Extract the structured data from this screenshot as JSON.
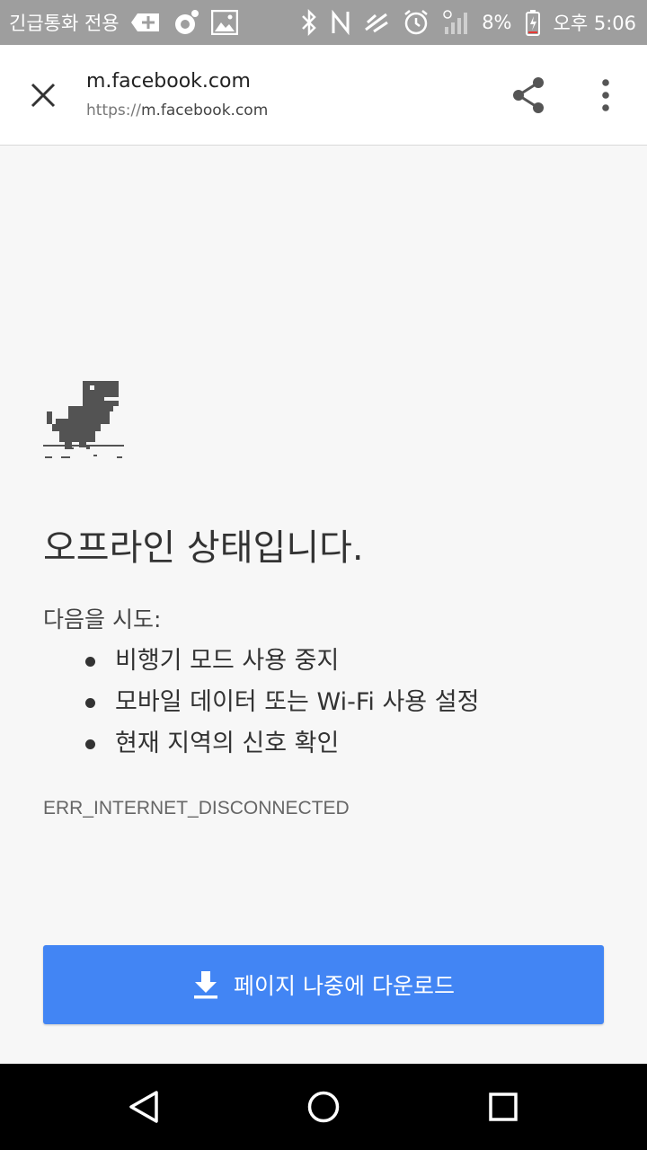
{
  "status_bar": {
    "carrier": "긴급통화 전용",
    "battery": "8%",
    "time": "오후 5:06",
    "icons": [
      "add-box-icon",
      "camera-icon",
      "image-icon",
      "bluetooth-icon",
      "nfc-icon",
      "data-off-icon",
      "alarm-icon",
      "signal-icon",
      "battery-icon"
    ]
  },
  "toolbar": {
    "title": "m.facebook.com",
    "url_scheme": "https://",
    "url_host": "m.facebook.com",
    "close_icon": "close-icon",
    "share_icon": "share-icon",
    "menu_icon": "more-vert-icon"
  },
  "offline": {
    "heading": "오프라인 상태입니다.",
    "suggest_intro": "다음을 시도:",
    "suggestions": [
      "비행기 모드 사용 중지",
      "모바일 데이터 또는 Wi-Fi 사용 설정",
      "현재 지역의 신호 확인"
    ],
    "error_code": "ERR_INTERNET_DISCONNECTED",
    "download_label": "페이지 나중에 다운로드",
    "download_icon": "download-icon",
    "illustration": "dino-icon"
  },
  "nav_bar": {
    "icons": [
      "back-icon",
      "home-icon",
      "recents-icon"
    ]
  },
  "colors": {
    "accent": "#4285f4",
    "status_bar": "#9e9e9e",
    "background": "#f7f7f7"
  }
}
